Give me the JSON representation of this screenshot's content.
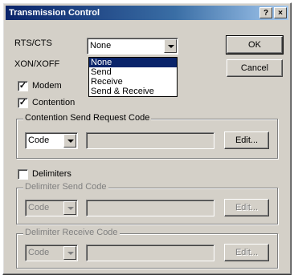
{
  "window": {
    "title": "Transmission Control",
    "help_button": "?",
    "close_button": "×"
  },
  "buttons": {
    "ok": "OK",
    "cancel": "Cancel"
  },
  "rts_cts": {
    "label": "RTS/CTS",
    "value": "None",
    "dropdown_options": [
      "None",
      "Send",
      "Receive",
      "Send & Receive"
    ]
  },
  "xon_xoff": {
    "label": "XON/XOFF"
  },
  "modem": {
    "label": "Modem",
    "checked": true,
    "check_mark": "✓"
  },
  "contention": {
    "label": "Contention",
    "checked": true,
    "check_mark": "✓"
  },
  "contention_send_group": {
    "title": "Contention Send Request Code",
    "type_value": "Code",
    "edit_label": "Edit..."
  },
  "delimiters": {
    "label": "Delimiters",
    "checked": false
  },
  "delimiter_send_group": {
    "title": "Delimiter Send Code",
    "type_value": "Code",
    "edit_label": "Edit..."
  },
  "delimiter_receive_group": {
    "title": "Delimiter Receive Code",
    "type_value": "Code",
    "edit_label": "Edit..."
  }
}
